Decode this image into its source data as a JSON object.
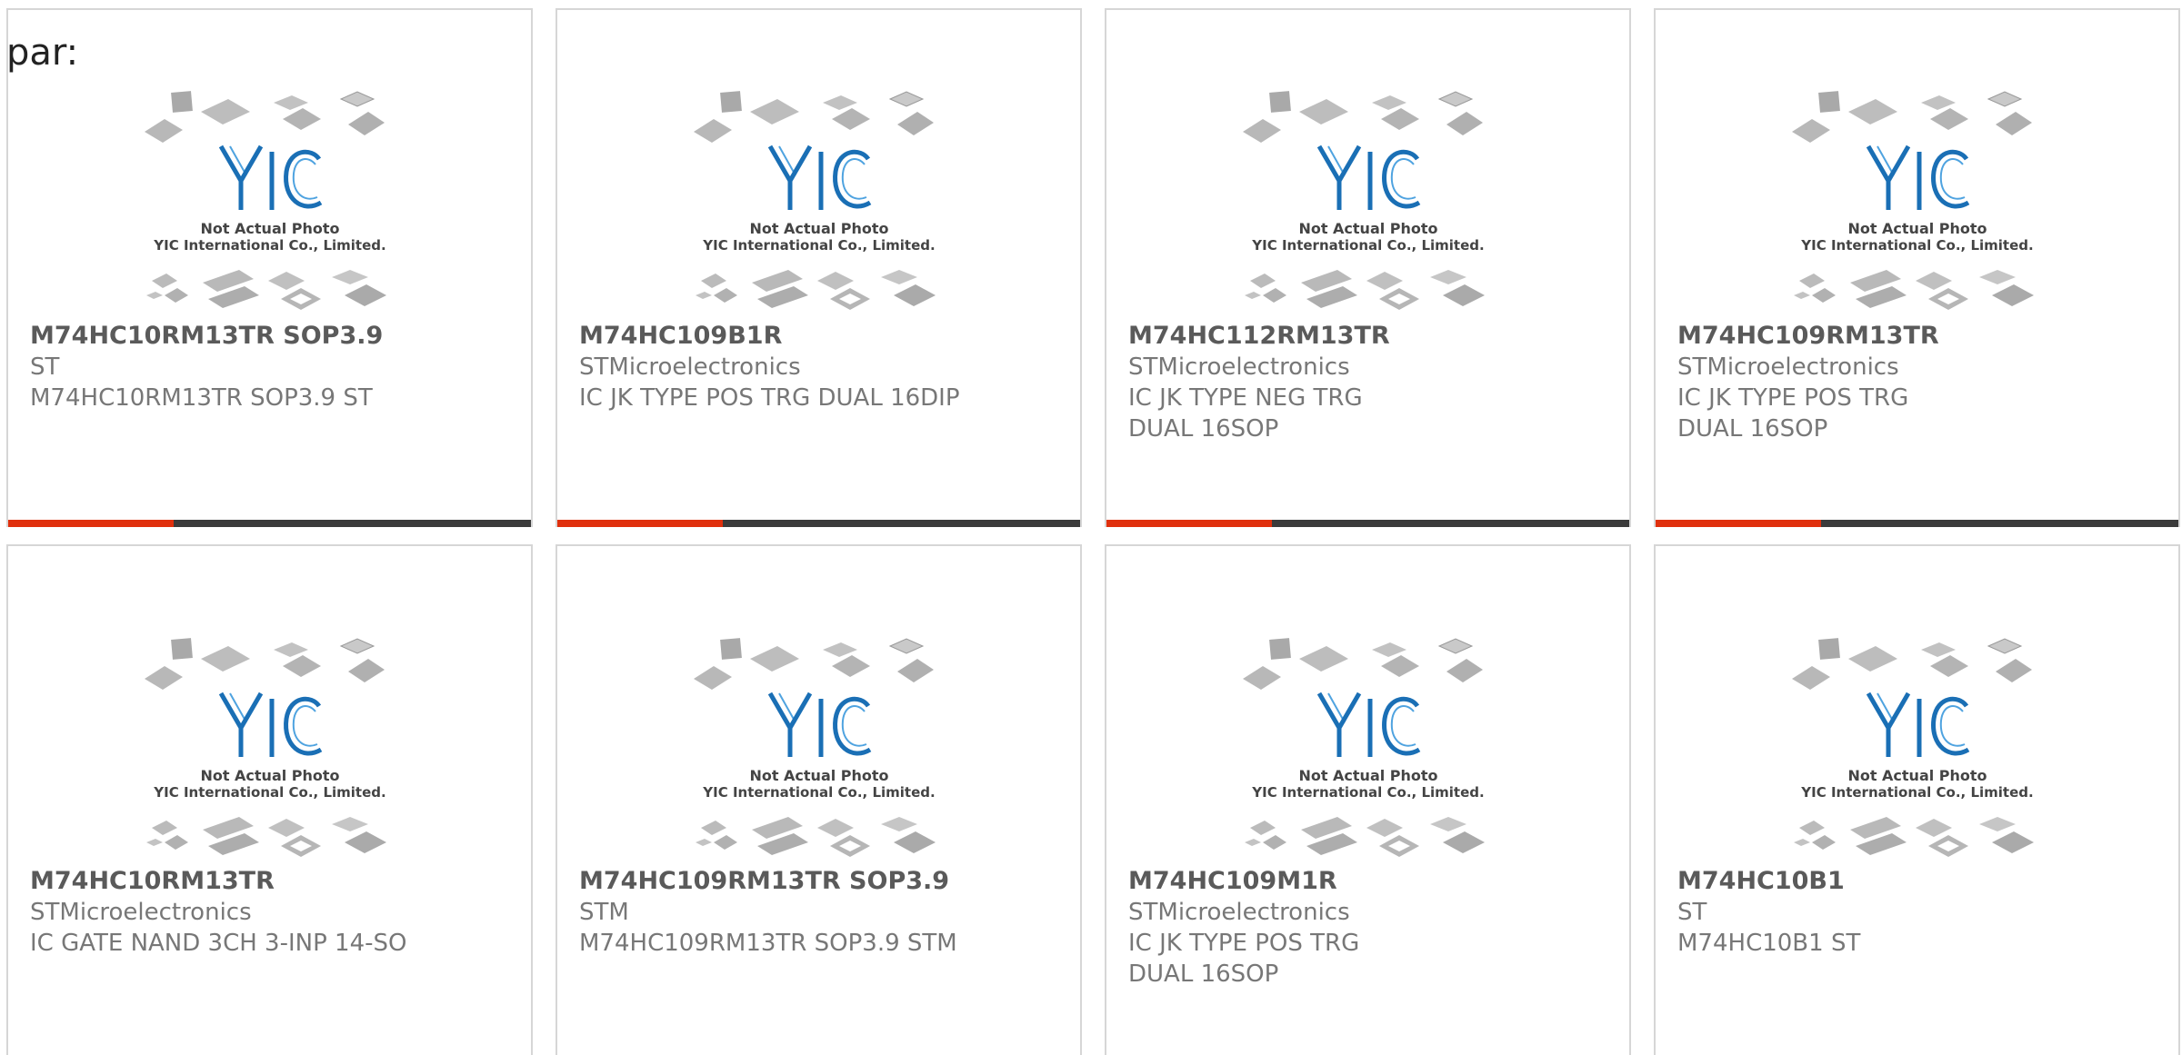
{
  "page": {
    "prefix_text": "par:"
  },
  "placeholder_image": {
    "line1": "Not Actual Photo",
    "line2": "YIC International Co., Limited.",
    "logo_text": "YIC"
  },
  "colors": {
    "accent": "#e0300d",
    "bar": "#3b3b3b",
    "logo_blue": "#1a6fb5",
    "border": "#d6d6d6"
  },
  "products": [
    {
      "part_number": "M74HC10RM13TR SOP3.9",
      "manufacturer": "ST",
      "description": "M74HC10RM13TR SOP3.9 ST"
    },
    {
      "part_number": "M74HC109B1R",
      "manufacturer": "STMicroelectronics",
      "description": "IC JK TYPE POS TRG DUAL 16DIP"
    },
    {
      "part_number": "M74HC112RM13TR",
      "manufacturer": "STMicroelectronics",
      "description": "IC JK TYPE NEG TRG DUAL 16SOP"
    },
    {
      "part_number": "M74HC109RM13TR",
      "manufacturer": "STMicroelectronics",
      "description": "IC JK TYPE POS TRG DUAL 16SOP"
    },
    {
      "part_number": "M74HC10RM13TR",
      "manufacturer": "STMicroelectronics",
      "description": "IC GATE NAND 3CH 3-INP 14-SO"
    },
    {
      "part_number": "M74HC109RM13TR SOP3.9",
      "manufacturer": "STM",
      "description": "M74HC109RM13TR SOP3.9 STM"
    },
    {
      "part_number": "M74HC109M1R",
      "manufacturer": "STMicroelectronics",
      "description": "IC JK TYPE POS TRG DUAL 16SOP"
    },
    {
      "part_number": "M74HC10B1",
      "manufacturer": "ST",
      "description": "M74HC10B1 ST"
    }
  ]
}
